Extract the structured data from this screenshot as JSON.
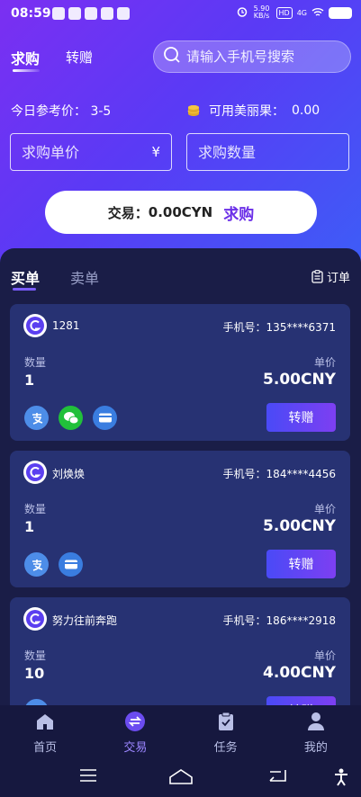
{
  "status": {
    "time": "08:59",
    "net_speed": "5.90 KB/s",
    "hd": "HD",
    "signal": "4G"
  },
  "header": {
    "tab_active": "求购",
    "tab_other": "转赠",
    "search_placeholder": "请输入手机号搜索"
  },
  "info": {
    "ref_price_label": "今日参考价：",
    "ref_price_value": "3-5",
    "available_label": "可用美丽果：",
    "available_value": "0.00"
  },
  "form": {
    "unit_price_placeholder": "求购单价",
    "currency_symbol": "¥",
    "quantity_placeholder": "求购数量"
  },
  "deal": {
    "label": "交易：",
    "amount": "0.00CYN",
    "action": "求购"
  },
  "panel": {
    "tab_buy": "买单",
    "tab_sell": "卖单",
    "orders_label": "订单"
  },
  "cards": [
    {
      "user": "1281",
      "phone_label": "手机号：",
      "phone": "135****6371",
      "qty_label": "数量",
      "qty": "1",
      "price_label": "单价",
      "price": "5.00CNY",
      "button": "转赠",
      "payments": [
        "alipay-icon",
        "wechat-icon",
        "bank-card-icon"
      ]
    },
    {
      "user": "刘焕焕",
      "phone_label": "手机号：",
      "phone": "184****4456",
      "qty_label": "数量",
      "qty": "1",
      "price_label": "单价",
      "price": "5.00CNY",
      "button": "转赠",
      "payments": [
        "alipay-icon",
        "bank-card-icon"
      ]
    },
    {
      "user": "努力往前奔跑",
      "phone_label": "手机号：",
      "phone": "186****2918",
      "qty_label": "数量",
      "qty": "10",
      "price_label": "单价",
      "price": "4.00CNY",
      "button": "转赠",
      "payments": [
        "alipay-icon"
      ]
    }
  ],
  "nav": [
    {
      "label": "首页",
      "icon": "home-icon"
    },
    {
      "label": "交易",
      "icon": "exchange-icon",
      "active": true
    },
    {
      "label": "任务",
      "icon": "task-icon"
    },
    {
      "label": "我的",
      "icon": "profile-icon"
    }
  ],
  "colors": {
    "gradient_start": "#7b2ff2",
    "gradient_end": "#3d5df7",
    "card_bg": "#273273",
    "panel_bg": "#1a1d47",
    "accent": "#6b2fe8"
  }
}
